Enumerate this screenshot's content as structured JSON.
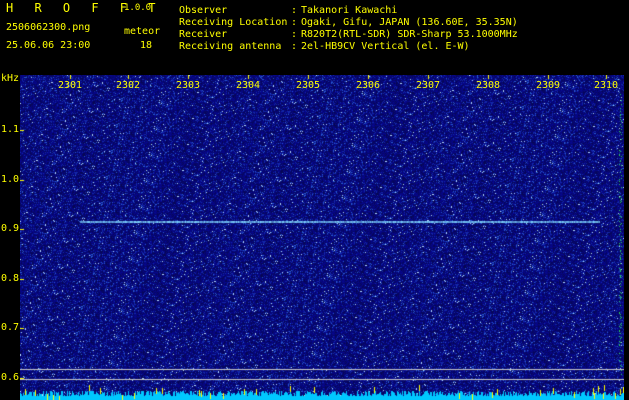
{
  "header": {
    "app_name": "H R O F F T",
    "version": "1.0.0",
    "filename": "2506062300.png",
    "datetime": "25.06.06 23:00",
    "meteor_label": "meteor",
    "meteor_count": "18",
    "observer_label": "Observer",
    "observer_value": "Takanori Kawachi",
    "location_label": "Receiving Location",
    "location_value": "Ogaki, Gifu, JAPAN (136.60E, 35.35N)",
    "receiver_label": "Receiver",
    "receiver_value": "R820T2(RTL-SDR) SDR-Sharp 53.1000MHz",
    "antenna_label": "Receiving antenna",
    "antenna_value": "2el-HB9CV Vertical (el. E-W)",
    "colon": ":"
  },
  "axis": {
    "unit": "kHz",
    "x_ticks": [
      "2301",
      "2302",
      "2303",
      "2304",
      "2305",
      "2306",
      "2307",
      "2308",
      "2309",
      "2310"
    ],
    "y_ticks": [
      "1.1",
      "1.0",
      "0.9",
      "0.8",
      "0.7",
      "0.6"
    ]
  },
  "colors": {
    "text": "#ffff00",
    "noise_bg": "#0a0a8a",
    "trace": "#7fd6ff",
    "bottom_band": "#00c8ff"
  }
}
